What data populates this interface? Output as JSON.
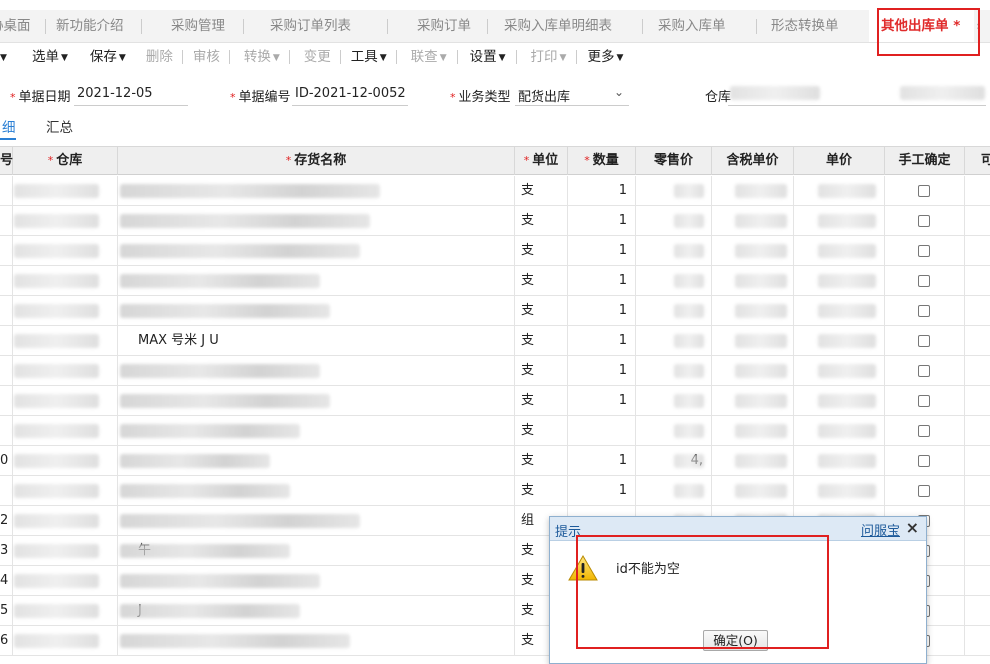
{
  "tabs": [
    {
      "label": "协桌面"
    },
    {
      "label": "新功能介绍"
    },
    {
      "label": "采购管理"
    },
    {
      "label": "采购订单列表"
    },
    {
      "label": "采购订单"
    },
    {
      "label": "采购入库单明细表"
    },
    {
      "label": "采购入库单"
    },
    {
      "label": "形态转换单"
    },
    {
      "label": "其他出库单 *"
    }
  ],
  "toolbar": {
    "items": [
      {
        "label": "选单"
      },
      {
        "label": "保存"
      },
      {
        "label": "删除"
      },
      {
        "label": "审核"
      },
      {
        "label": "转换"
      },
      {
        "label": "变更"
      },
      {
        "label": "工具"
      },
      {
        "label": "联查"
      },
      {
        "label": "设置"
      },
      {
        "label": "打印"
      },
      {
        "label": "更多"
      }
    ]
  },
  "form": {
    "date_label": "单据日期",
    "date_value": "2021-12-05",
    "number_label": "单据编号",
    "number_value": "ID-2021-12-0052",
    "biztype_label": "业务类型",
    "biztype_value": "配货出库",
    "warehouse_label": "仓库"
  },
  "subtabs": [
    {
      "label": "细"
    },
    {
      "label": "汇总"
    }
  ],
  "grid": {
    "columns": {
      "seq": "号",
      "warehouse": "仓库",
      "name": "存货名称",
      "unit": "单位",
      "qty": "数量",
      "retail": "零售价",
      "taxprice": "含税单价",
      "price": "单价",
      "manual": "手工确定",
      "extra": "可"
    },
    "rows": [
      {
        "seq": "",
        "unit": "支",
        "qty": "1",
        "retail": "",
        "name": ""
      },
      {
        "seq": "",
        "unit": "支",
        "qty": "1",
        "retail": "",
        "name": ""
      },
      {
        "seq": "",
        "unit": "支",
        "qty": "1",
        "retail": "",
        "name": ""
      },
      {
        "seq": "",
        "unit": "支",
        "qty": "1",
        "retail": "",
        "name": ""
      },
      {
        "seq": "",
        "unit": "支",
        "qty": "1",
        "retail": "",
        "name": ""
      },
      {
        "seq": "",
        "unit": "支",
        "qty": "1",
        "retail": "",
        "name": "MAX 号米 J U"
      },
      {
        "seq": "",
        "unit": "支",
        "qty": "1",
        "retail": "",
        "name": ""
      },
      {
        "seq": "",
        "unit": "支",
        "qty": "1",
        "retail": "",
        "name": ""
      },
      {
        "seq": "",
        "unit": "支",
        "qty": "",
        "retail": "",
        "name": ""
      },
      {
        "seq": "0",
        "unit": "支",
        "qty": "1",
        "retail": "4,",
        "name": ""
      },
      {
        "seq": "",
        "unit": "支",
        "qty": "1",
        "retail": "",
        "name": ""
      },
      {
        "seq": "2",
        "unit": "组",
        "qty": "",
        "retail": "",
        "name": ""
      },
      {
        "seq": "3",
        "unit": "支",
        "qty": "",
        "retail": "",
        "name": "午"
      },
      {
        "seq": "4",
        "unit": "支",
        "qty": "",
        "retail": "",
        "name": ""
      },
      {
        "seq": "5",
        "unit": "支",
        "qty": "",
        "retail": "",
        "name": "J"
      },
      {
        "seq": "6",
        "unit": "支",
        "qty": "",
        "retail": "",
        "name": ""
      }
    ]
  },
  "dialog": {
    "title": "提示",
    "help_link": "问服宝",
    "close": "×",
    "message": "id不能为空",
    "ok_button": "确定(O)"
  },
  "colors": {
    "active_tab": "#e02b2b",
    "highlight_box": "#e02020",
    "link_blue": "#1d5a9a",
    "subtab_active": "#2a7fd4"
  }
}
